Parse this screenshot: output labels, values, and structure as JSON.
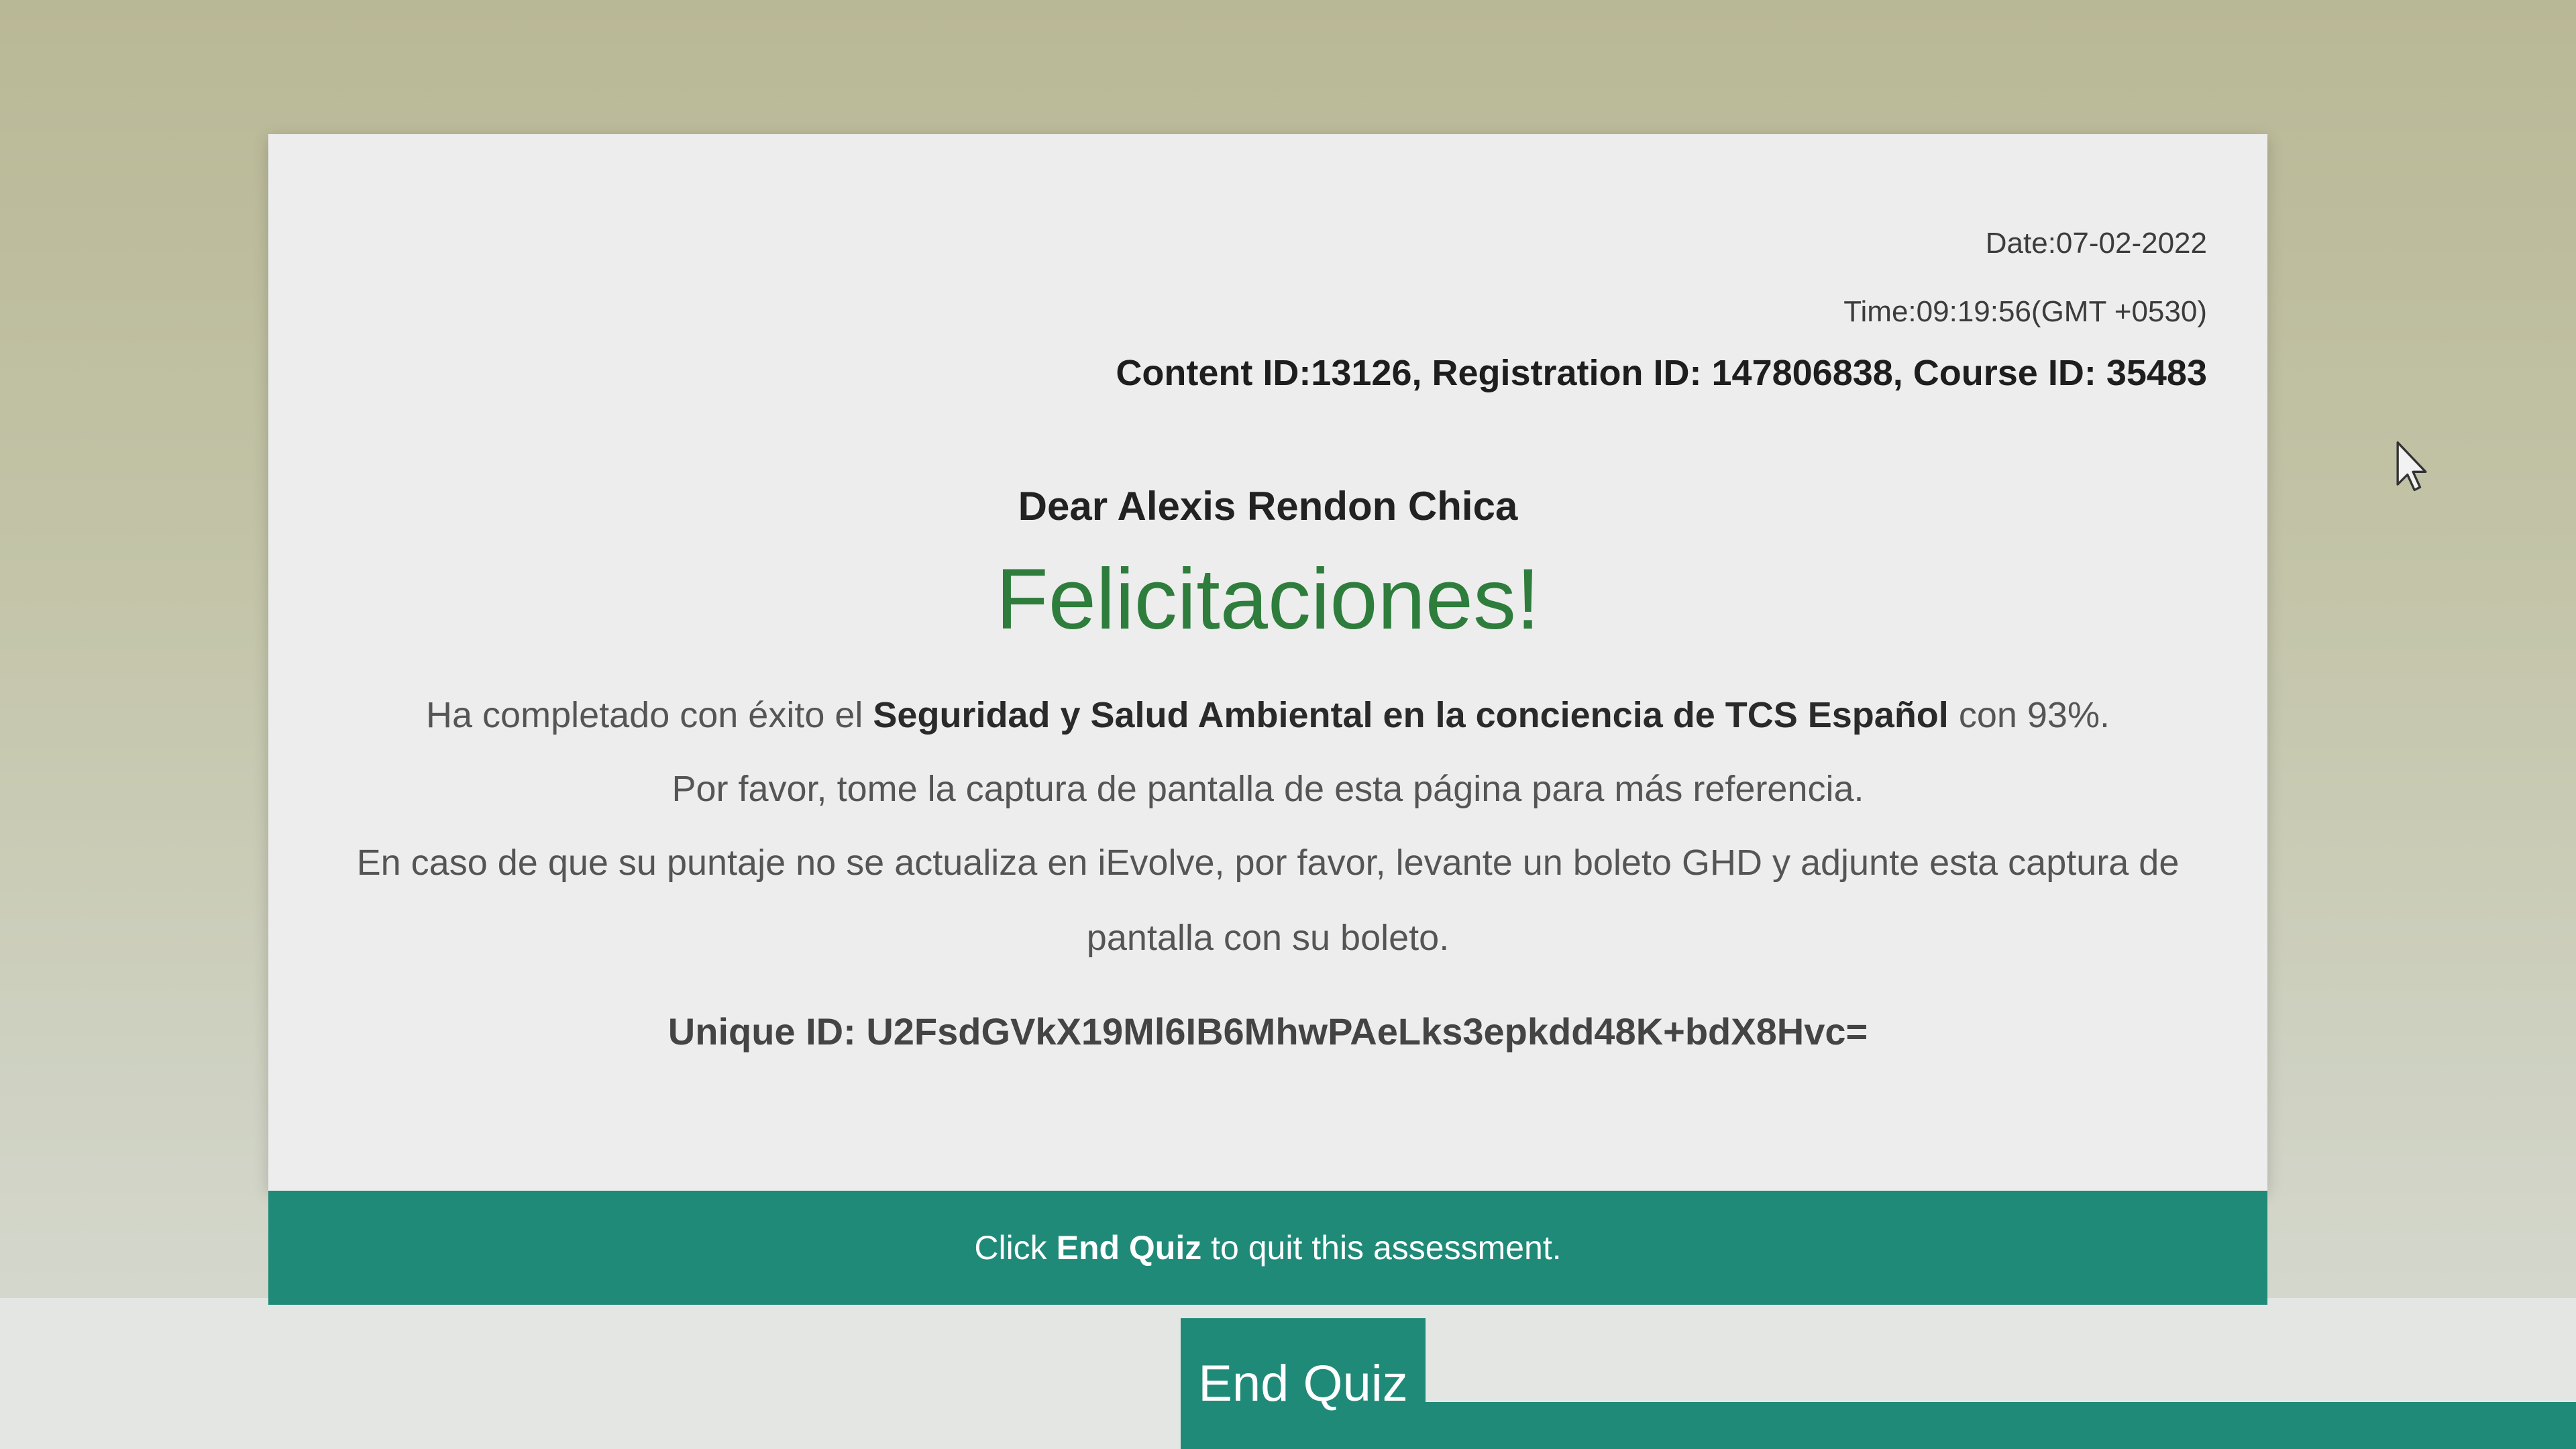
{
  "header": {
    "date": "Date:07-02-2022",
    "time": "Time:09:19:56(GMT +0530)",
    "ids": "Content ID:13126, Registration ID: 147806838, Course ID: 35483"
  },
  "message": {
    "greeting": "Dear Alexis Rendon Chica",
    "congrats": "Felicitaciones!",
    "line1_prefix": "Ha completado con éxito el",
    "course_name": "Seguridad y Salud Ambiental en la conciencia de TCS Español",
    "line1_suffix": "con 93%.",
    "line2": "Por favor, tome la captura de pantalla de esta página para más referencia.",
    "line3": "En caso de que su puntaje no se actualiza en iEvolve, por favor, levante un boleto GHD y adjunte esta captura de pantalla con su boleto.",
    "unique_id": "Unique ID: U2FsdGVkX19Ml6IB6MhwPAeLks3epkdd48K+bdX8Hvc="
  },
  "banner": {
    "prefix": "Click",
    "emphasis": "End Quiz",
    "suffix": "to quit this assessment."
  },
  "actions": {
    "end_quiz_label": "End Quiz"
  },
  "colors": {
    "accent": "#1f8a78",
    "congrats_green": "#2e7d3c"
  },
  "icons": {
    "cursor": "mouse-pointer-icon"
  }
}
